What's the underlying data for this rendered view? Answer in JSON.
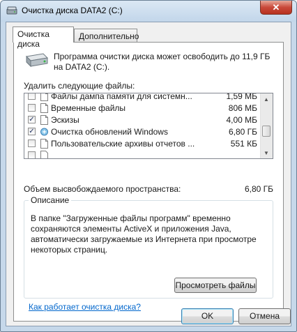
{
  "window": {
    "title": "Очистка диска DATA2 (C:)",
    "close_symbol": "✕"
  },
  "tabs": [
    {
      "label": "Очистка диска",
      "active": true
    },
    {
      "label": "Дополнительно",
      "active": false
    }
  ],
  "intro_text": "Программа очистки диска может освободить до 11,9 ГБ на DATA2 (C:).",
  "list_label": "Удалить следующие файлы:",
  "file_items": [
    {
      "label": "Файлы дампа памяти для системн...",
      "size": "1,59 МБ",
      "checked": false
    },
    {
      "label": "Временные файлы",
      "size": "806 МБ",
      "checked": false
    },
    {
      "label": "Эскизы",
      "size": "4,00 МБ",
      "checked": true
    },
    {
      "label": "Очистка обновлений Windows",
      "size": "6,80 ГБ",
      "checked": true
    },
    {
      "label": "Пользовательские архивы отчетов ...",
      "size": "551 КБ",
      "checked": false
    }
  ],
  "check_mark": "✓",
  "freed_space": {
    "label": "Объем высвобождаемого пространства:",
    "value": "6,80 ГБ"
  },
  "description": {
    "title": "Описание",
    "text": "В папке \"Загруженные файлы программ\" временно сохраняются элементы ActiveX и приложения Java, автоматически загружаемые из Интернета при просмотре некоторых страниц.",
    "view_files_label": "Просмотреть файлы"
  },
  "help_link": "Как работает очистка диска?",
  "buttons": {
    "ok": "OK",
    "cancel": "Отмена"
  },
  "scroll_arrows": {
    "up": "▲",
    "down": "▼"
  },
  "colors": {
    "link": "#0066cc",
    "title_bar": "#c6d8ea",
    "close_button": "#c9493a"
  }
}
